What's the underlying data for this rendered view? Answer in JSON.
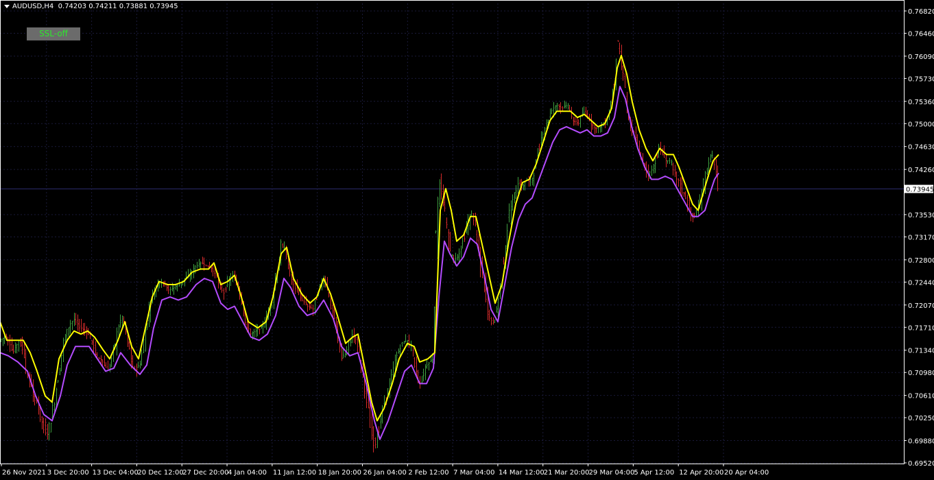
{
  "header": {
    "symbol": "AUDUSD,H4",
    "ohlc": "0.74203 0.74211 0.73881 0.73945"
  },
  "ssl_button": {
    "label": "SSL-off"
  },
  "colors": {
    "background": "#000000",
    "axis": "#ffffff",
    "grid": "#1a1a3a",
    "bull": "#3fa03f",
    "bear": "#d42a2a",
    "ssl_up": "#ffff00",
    "ssl_down": "#b44cff"
  },
  "chart_data": {
    "type": "line",
    "title": "",
    "xlabel": "",
    "ylabel": "",
    "y_ticks": [
      "0.76820",
      "0.76460",
      "0.76090",
      "0.75730",
      "0.75360",
      "0.75000",
      "0.74630",
      "0.74260",
      "0.73530",
      "0.73170",
      "0.72800",
      "0.72440",
      "0.72070",
      "0.71710",
      "0.71340",
      "0.70980",
      "0.70610",
      "0.70250",
      "0.69880",
      "0.69520"
    ],
    "ylim": [
      0.6952,
      0.7682
    ],
    "current_price": "0.73945",
    "x_ticks": [
      "26 Nov 2021",
      "3 Dec 20:00",
      "13 Dec 04:00",
      "20 Dec 12:00",
      "27 Dec 20:00",
      "4 Jan 04:00",
      "11 Jan 12:00",
      "18 Jan 20:00",
      "26 Jan 04:00",
      "2 Feb 12:00",
      "7 Mar 04:00",
      "14 Mar 12:00",
      "21 Mar 20:00",
      "29 Mar 04:00",
      "5 Apr 12:00",
      "12 Apr 20:00",
      "20 Apr 04:00"
    ],
    "grid": true,
    "price_path": [
      [
        0,
        0.715
      ],
      [
        8,
        0.7155
      ],
      [
        20,
        0.713
      ],
      [
        30,
        0.7155
      ],
      [
        38,
        0.7105
      ],
      [
        46,
        0.7075
      ],
      [
        55,
        0.7045
      ],
      [
        64,
        0.701
      ],
      [
        70,
        0.6995
      ],
      [
        78,
        0.704
      ],
      [
        86,
        0.7095
      ],
      [
        94,
        0.715
      ],
      [
        102,
        0.7175
      ],
      [
        110,
        0.7185
      ],
      [
        118,
        0.717
      ],
      [
        126,
        0.7165
      ],
      [
        134,
        0.715
      ],
      [
        142,
        0.7125
      ],
      [
        150,
        0.7115
      ],
      [
        158,
        0.71
      ],
      [
        166,
        0.713
      ],
      [
        174,
        0.7175
      ],
      [
        180,
        0.719
      ],
      [
        186,
        0.7155
      ],
      [
        192,
        0.712
      ],
      [
        198,
        0.71
      ],
      [
        206,
        0.7115
      ],
      [
        214,
        0.7175
      ],
      [
        222,
        0.722
      ],
      [
        230,
        0.724
      ],
      [
        238,
        0.7245
      ],
      [
        246,
        0.723
      ],
      [
        254,
        0.7235
      ],
      [
        262,
        0.724
      ],
      [
        270,
        0.725
      ],
      [
        278,
        0.7255
      ],
      [
        286,
        0.727
      ],
      [
        294,
        0.7275
      ],
      [
        302,
        0.727
      ],
      [
        310,
        0.7265
      ],
      [
        318,
        0.725
      ],
      [
        326,
        0.7225
      ],
      [
        334,
        0.7245
      ],
      [
        342,
        0.7255
      ],
      [
        350,
        0.722
      ],
      [
        358,
        0.718
      ],
      [
        366,
        0.716
      ],
      [
        374,
        0.7165
      ],
      [
        382,
        0.717
      ],
      [
        390,
        0.7185
      ],
      [
        398,
        0.722
      ],
      [
        406,
        0.727
      ],
      [
        412,
        0.731
      ],
      [
        418,
        0.7285
      ],
      [
        426,
        0.725
      ],
      [
        434,
        0.723
      ],
      [
        442,
        0.7215
      ],
      [
        450,
        0.7205
      ],
      [
        458,
        0.72
      ],
      [
        466,
        0.7235
      ],
      [
        474,
        0.725
      ],
      [
        482,
        0.721
      ],
      [
        490,
        0.7185
      ],
      [
        498,
        0.712
      ],
      [
        506,
        0.713
      ],
      [
        514,
        0.716
      ],
      [
        522,
        0.715
      ],
      [
        530,
        0.709
      ],
      [
        538,
        0.704
      ],
      [
        546,
        0.6975
      ],
      [
        554,
        0.701
      ],
      [
        562,
        0.7055
      ],
      [
        570,
        0.708
      ],
      [
        578,
        0.712
      ],
      [
        586,
        0.7145
      ],
      [
        594,
        0.715
      ],
      [
        602,
        0.714
      ],
      [
        608,
        0.7095
      ],
      [
        614,
        0.7075
      ],
      [
        620,
        0.7105
      ],
      [
        626,
        0.7115
      ],
      [
        632,
        0.712
      ],
      [
        636,
        0.7325
      ],
      [
        640,
        0.7415
      ],
      [
        644,
        0.74
      ],
      [
        650,
        0.7355
      ],
      [
        656,
        0.7295
      ],
      [
        662,
        0.728
      ],
      [
        668,
        0.7285
      ],
      [
        676,
        0.731
      ],
      [
        684,
        0.7345
      ],
      [
        690,
        0.7355
      ],
      [
        696,
        0.732
      ],
      [
        702,
        0.727
      ],
      [
        708,
        0.723
      ],
      [
        714,
        0.7185
      ],
      [
        720,
        0.7175
      ],
      [
        726,
        0.7205
      ],
      [
        732,
        0.725
      ],
      [
        738,
        0.731
      ],
      [
        744,
        0.736
      ],
      [
        750,
        0.738
      ],
      [
        756,
        0.7405
      ],
      [
        762,
        0.7395
      ],
      [
        768,
        0.741
      ],
      [
        774,
        0.7405
      ],
      [
        780,
        0.742
      ],
      [
        786,
        0.746
      ],
      [
        792,
        0.7485
      ],
      [
        798,
        0.75
      ],
      [
        804,
        0.752
      ],
      [
        812,
        0.753
      ],
      [
        820,
        0.7525
      ],
      [
        828,
        0.753
      ],
      [
        836,
        0.7505
      ],
      [
        844,
        0.75
      ],
      [
        852,
        0.752
      ],
      [
        860,
        0.7505
      ],
      [
        868,
        0.749
      ],
      [
        876,
        0.7495
      ],
      [
        884,
        0.75
      ],
      [
        890,
        0.7525
      ],
      [
        896,
        0.7565
      ],
      [
        900,
        0.764
      ],
      [
        904,
        0.762
      ],
      [
        910,
        0.757
      ],
      [
        916,
        0.752
      ],
      [
        922,
        0.749
      ],
      [
        930,
        0.747
      ],
      [
        938,
        0.744
      ],
      [
        946,
        0.7415
      ],
      [
        954,
        0.743
      ],
      [
        962,
        0.7465
      ],
      [
        970,
        0.744
      ],
      [
        978,
        0.744
      ],
      [
        986,
        0.742
      ],
      [
        994,
        0.7395
      ],
      [
        1002,
        0.7375
      ],
      [
        1008,
        0.7355
      ],
      [
        1014,
        0.735
      ],
      [
        1020,
        0.7365
      ],
      [
        1026,
        0.74
      ],
      [
        1032,
        0.743
      ],
      [
        1038,
        0.745
      ],
      [
        1044,
        0.743
      ],
      [
        1048,
        0.7395
      ]
    ],
    "ssl_upper": [
      [
        0,
        0.718
      ],
      [
        10,
        0.715
      ],
      [
        22,
        0.715
      ],
      [
        34,
        0.715
      ],
      [
        44,
        0.713
      ],
      [
        54,
        0.71
      ],
      [
        66,
        0.706
      ],
      [
        76,
        0.705
      ],
      [
        86,
        0.712
      ],
      [
        98,
        0.715
      ],
      [
        108,
        0.7165
      ],
      [
        118,
        0.716
      ],
      [
        128,
        0.7165
      ],
      [
        138,
        0.7155
      ],
      [
        150,
        0.7135
      ],
      [
        160,
        0.712
      ],
      [
        172,
        0.715
      ],
      [
        182,
        0.718
      ],
      [
        192,
        0.714
      ],
      [
        202,
        0.712
      ],
      [
        212,
        0.717
      ],
      [
        222,
        0.722
      ],
      [
        232,
        0.7245
      ],
      [
        244,
        0.724
      ],
      [
        256,
        0.724
      ],
      [
        268,
        0.7245
      ],
      [
        280,
        0.726
      ],
      [
        292,
        0.7265
      ],
      [
        304,
        0.7265
      ],
      [
        312,
        0.7275
      ],
      [
        322,
        0.724
      ],
      [
        332,
        0.7245
      ],
      [
        342,
        0.7255
      ],
      [
        352,
        0.722
      ],
      [
        362,
        0.718
      ],
      [
        376,
        0.717
      ],
      [
        388,
        0.718
      ],
      [
        398,
        0.722
      ],
      [
        410,
        0.729
      ],
      [
        418,
        0.73
      ],
      [
        428,
        0.725
      ],
      [
        440,
        0.7225
      ],
      [
        452,
        0.721
      ],
      [
        462,
        0.722
      ],
      [
        472,
        0.725
      ],
      [
        482,
        0.7225
      ],
      [
        492,
        0.719
      ],
      [
        504,
        0.7145
      ],
      [
        514,
        0.7155
      ],
      [
        522,
        0.716
      ],
      [
        532,
        0.7105
      ],
      [
        542,
        0.705
      ],
      [
        550,
        0.702
      ],
      [
        560,
        0.704
      ],
      [
        572,
        0.708
      ],
      [
        582,
        0.712
      ],
      [
        594,
        0.7145
      ],
      [
        604,
        0.714
      ],
      [
        612,
        0.7115
      ],
      [
        624,
        0.712
      ],
      [
        634,
        0.713
      ],
      [
        642,
        0.736
      ],
      [
        650,
        0.7395
      ],
      [
        658,
        0.736
      ],
      [
        666,
        0.731
      ],
      [
        676,
        0.732
      ],
      [
        686,
        0.735
      ],
      [
        694,
        0.735
      ],
      [
        702,
        0.731
      ],
      [
        712,
        0.726
      ],
      [
        722,
        0.721
      ],
      [
        732,
        0.724
      ],
      [
        742,
        0.731
      ],
      [
        752,
        0.737
      ],
      [
        762,
        0.7405
      ],
      [
        772,
        0.741
      ],
      [
        782,
        0.7435
      ],
      [
        792,
        0.747
      ],
      [
        802,
        0.7505
      ],
      [
        812,
        0.752
      ],
      [
        822,
        0.752
      ],
      [
        832,
        0.752
      ],
      [
        842,
        0.751
      ],
      [
        852,
        0.7515
      ],
      [
        862,
        0.7505
      ],
      [
        872,
        0.7495
      ],
      [
        882,
        0.75
      ],
      [
        892,
        0.7525
      ],
      [
        900,
        0.759
      ],
      [
        906,
        0.761
      ],
      [
        914,
        0.758
      ],
      [
        922,
        0.7535
      ],
      [
        932,
        0.749
      ],
      [
        942,
        0.746
      ],
      [
        952,
        0.744
      ],
      [
        962,
        0.746
      ],
      [
        972,
        0.745
      ],
      [
        982,
        0.745
      ],
      [
        990,
        0.743
      ],
      [
        1000,
        0.74
      ],
      [
        1010,
        0.737
      ],
      [
        1018,
        0.736
      ],
      [
        1026,
        0.739
      ],
      [
        1034,
        0.742
      ],
      [
        1040,
        0.744
      ],
      [
        1044,
        0.7445
      ],
      [
        1048,
        0.745
      ]
    ],
    "ssl_lower": [
      [
        0,
        0.713
      ],
      [
        12,
        0.7125
      ],
      [
        26,
        0.7115
      ],
      [
        40,
        0.71
      ],
      [
        52,
        0.706
      ],
      [
        64,
        0.703
      ],
      [
        76,
        0.702
      ],
      [
        88,
        0.706
      ],
      [
        98,
        0.711
      ],
      [
        110,
        0.714
      ],
      [
        120,
        0.714
      ],
      [
        130,
        0.714
      ],
      [
        142,
        0.712
      ],
      [
        154,
        0.71
      ],
      [
        166,
        0.7105
      ],
      [
        176,
        0.713
      ],
      [
        190,
        0.711
      ],
      [
        204,
        0.7095
      ],
      [
        214,
        0.711
      ],
      [
        224,
        0.717
      ],
      [
        236,
        0.7215
      ],
      [
        248,
        0.722
      ],
      [
        260,
        0.7215
      ],
      [
        272,
        0.722
      ],
      [
        286,
        0.724
      ],
      [
        298,
        0.725
      ],
      [
        310,
        0.7245
      ],
      [
        322,
        0.721
      ],
      [
        332,
        0.72
      ],
      [
        342,
        0.7205
      ],
      [
        354,
        0.718
      ],
      [
        366,
        0.7155
      ],
      [
        378,
        0.715
      ],
      [
        390,
        0.716
      ],
      [
        402,
        0.719
      ],
      [
        414,
        0.725
      ],
      [
        424,
        0.7235
      ],
      [
        436,
        0.7205
      ],
      [
        448,
        0.719
      ],
      [
        460,
        0.7195
      ],
      [
        472,
        0.7215
      ],
      [
        486,
        0.7185
      ],
      [
        498,
        0.714
      ],
      [
        510,
        0.7125
      ],
      [
        522,
        0.713
      ],
      [
        534,
        0.708
      ],
      [
        546,
        0.702
      ],
      [
        554,
        0.699
      ],
      [
        566,
        0.702
      ],
      [
        578,
        0.706
      ],
      [
        590,
        0.71
      ],
      [
        600,
        0.711
      ],
      [
        612,
        0.708
      ],
      [
        622,
        0.708
      ],
      [
        632,
        0.7105
      ],
      [
        640,
        0.722
      ],
      [
        648,
        0.731
      ],
      [
        656,
        0.729
      ],
      [
        666,
        0.727
      ],
      [
        676,
        0.7285
      ],
      [
        686,
        0.7315
      ],
      [
        696,
        0.7305
      ],
      [
        706,
        0.7255
      ],
      [
        716,
        0.72
      ],
      [
        726,
        0.718
      ],
      [
        736,
        0.724
      ],
      [
        746,
        0.73
      ],
      [
        756,
        0.7345
      ],
      [
        766,
        0.737
      ],
      [
        776,
        0.738
      ],
      [
        786,
        0.741
      ],
      [
        796,
        0.744
      ],
      [
        806,
        0.747
      ],
      [
        816,
        0.749
      ],
      [
        826,
        0.7495
      ],
      [
        836,
        0.749
      ],
      [
        846,
        0.7485
      ],
      [
        856,
        0.749
      ],
      [
        866,
        0.748
      ],
      [
        876,
        0.748
      ],
      [
        886,
        0.7485
      ],
      [
        896,
        0.751
      ],
      [
        904,
        0.756
      ],
      [
        912,
        0.754
      ],
      [
        920,
        0.75
      ],
      [
        930,
        0.746
      ],
      [
        940,
        0.743
      ],
      [
        950,
        0.741
      ],
      [
        960,
        0.741
      ],
      [
        970,
        0.7415
      ],
      [
        980,
        0.741
      ],
      [
        990,
        0.739
      ],
      [
        1000,
        0.737
      ],
      [
        1010,
        0.735
      ],
      [
        1018,
        0.735
      ],
      [
        1028,
        0.736
      ],
      [
        1036,
        0.739
      ],
      [
        1042,
        0.741
      ],
      [
        1048,
        0.742
      ]
    ]
  }
}
